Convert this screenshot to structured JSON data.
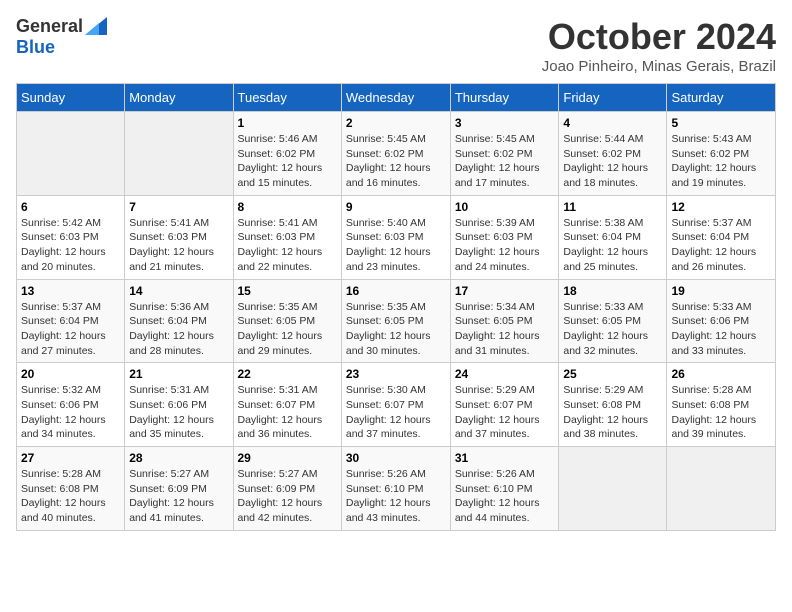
{
  "header": {
    "logo_general": "General",
    "logo_blue": "Blue",
    "month_title": "October 2024",
    "location": "Joao Pinheiro, Minas Gerais, Brazil"
  },
  "days_of_week": [
    "Sunday",
    "Monday",
    "Tuesday",
    "Wednesday",
    "Thursday",
    "Friday",
    "Saturday"
  ],
  "weeks": [
    [
      {
        "day": "",
        "sunrise": "",
        "sunset": "",
        "daylight": ""
      },
      {
        "day": "",
        "sunrise": "",
        "sunset": "",
        "daylight": ""
      },
      {
        "day": "1",
        "sunrise": "Sunrise: 5:46 AM",
        "sunset": "Sunset: 6:02 PM",
        "daylight": "Daylight: 12 hours and 15 minutes."
      },
      {
        "day": "2",
        "sunrise": "Sunrise: 5:45 AM",
        "sunset": "Sunset: 6:02 PM",
        "daylight": "Daylight: 12 hours and 16 minutes."
      },
      {
        "day": "3",
        "sunrise": "Sunrise: 5:45 AM",
        "sunset": "Sunset: 6:02 PM",
        "daylight": "Daylight: 12 hours and 17 minutes."
      },
      {
        "day": "4",
        "sunrise": "Sunrise: 5:44 AM",
        "sunset": "Sunset: 6:02 PM",
        "daylight": "Daylight: 12 hours and 18 minutes."
      },
      {
        "day": "5",
        "sunrise": "Sunrise: 5:43 AM",
        "sunset": "Sunset: 6:02 PM",
        "daylight": "Daylight: 12 hours and 19 minutes."
      }
    ],
    [
      {
        "day": "6",
        "sunrise": "Sunrise: 5:42 AM",
        "sunset": "Sunset: 6:03 PM",
        "daylight": "Daylight: 12 hours and 20 minutes."
      },
      {
        "day": "7",
        "sunrise": "Sunrise: 5:41 AM",
        "sunset": "Sunset: 6:03 PM",
        "daylight": "Daylight: 12 hours and 21 minutes."
      },
      {
        "day": "8",
        "sunrise": "Sunrise: 5:41 AM",
        "sunset": "Sunset: 6:03 PM",
        "daylight": "Daylight: 12 hours and 22 minutes."
      },
      {
        "day": "9",
        "sunrise": "Sunrise: 5:40 AM",
        "sunset": "Sunset: 6:03 PM",
        "daylight": "Daylight: 12 hours and 23 minutes."
      },
      {
        "day": "10",
        "sunrise": "Sunrise: 5:39 AM",
        "sunset": "Sunset: 6:03 PM",
        "daylight": "Daylight: 12 hours and 24 minutes."
      },
      {
        "day": "11",
        "sunrise": "Sunrise: 5:38 AM",
        "sunset": "Sunset: 6:04 PM",
        "daylight": "Daylight: 12 hours and 25 minutes."
      },
      {
        "day": "12",
        "sunrise": "Sunrise: 5:37 AM",
        "sunset": "Sunset: 6:04 PM",
        "daylight": "Daylight: 12 hours and 26 minutes."
      }
    ],
    [
      {
        "day": "13",
        "sunrise": "Sunrise: 5:37 AM",
        "sunset": "Sunset: 6:04 PM",
        "daylight": "Daylight: 12 hours and 27 minutes."
      },
      {
        "day": "14",
        "sunrise": "Sunrise: 5:36 AM",
        "sunset": "Sunset: 6:04 PM",
        "daylight": "Daylight: 12 hours and 28 minutes."
      },
      {
        "day": "15",
        "sunrise": "Sunrise: 5:35 AM",
        "sunset": "Sunset: 6:05 PM",
        "daylight": "Daylight: 12 hours and 29 minutes."
      },
      {
        "day": "16",
        "sunrise": "Sunrise: 5:35 AM",
        "sunset": "Sunset: 6:05 PM",
        "daylight": "Daylight: 12 hours and 30 minutes."
      },
      {
        "day": "17",
        "sunrise": "Sunrise: 5:34 AM",
        "sunset": "Sunset: 6:05 PM",
        "daylight": "Daylight: 12 hours and 31 minutes."
      },
      {
        "day": "18",
        "sunrise": "Sunrise: 5:33 AM",
        "sunset": "Sunset: 6:05 PM",
        "daylight": "Daylight: 12 hours and 32 minutes."
      },
      {
        "day": "19",
        "sunrise": "Sunrise: 5:33 AM",
        "sunset": "Sunset: 6:06 PM",
        "daylight": "Daylight: 12 hours and 33 minutes."
      }
    ],
    [
      {
        "day": "20",
        "sunrise": "Sunrise: 5:32 AM",
        "sunset": "Sunset: 6:06 PM",
        "daylight": "Daylight: 12 hours and 34 minutes."
      },
      {
        "day": "21",
        "sunrise": "Sunrise: 5:31 AM",
        "sunset": "Sunset: 6:06 PM",
        "daylight": "Daylight: 12 hours and 35 minutes."
      },
      {
        "day": "22",
        "sunrise": "Sunrise: 5:31 AM",
        "sunset": "Sunset: 6:07 PM",
        "daylight": "Daylight: 12 hours and 36 minutes."
      },
      {
        "day": "23",
        "sunrise": "Sunrise: 5:30 AM",
        "sunset": "Sunset: 6:07 PM",
        "daylight": "Daylight: 12 hours and 37 minutes."
      },
      {
        "day": "24",
        "sunrise": "Sunrise: 5:29 AM",
        "sunset": "Sunset: 6:07 PM",
        "daylight": "Daylight: 12 hours and 37 minutes."
      },
      {
        "day": "25",
        "sunrise": "Sunrise: 5:29 AM",
        "sunset": "Sunset: 6:08 PM",
        "daylight": "Daylight: 12 hours and 38 minutes."
      },
      {
        "day": "26",
        "sunrise": "Sunrise: 5:28 AM",
        "sunset": "Sunset: 6:08 PM",
        "daylight": "Daylight: 12 hours and 39 minutes."
      }
    ],
    [
      {
        "day": "27",
        "sunrise": "Sunrise: 5:28 AM",
        "sunset": "Sunset: 6:08 PM",
        "daylight": "Daylight: 12 hours and 40 minutes."
      },
      {
        "day": "28",
        "sunrise": "Sunrise: 5:27 AM",
        "sunset": "Sunset: 6:09 PM",
        "daylight": "Daylight: 12 hours and 41 minutes."
      },
      {
        "day": "29",
        "sunrise": "Sunrise: 5:27 AM",
        "sunset": "Sunset: 6:09 PM",
        "daylight": "Daylight: 12 hours and 42 minutes."
      },
      {
        "day": "30",
        "sunrise": "Sunrise: 5:26 AM",
        "sunset": "Sunset: 6:10 PM",
        "daylight": "Daylight: 12 hours and 43 minutes."
      },
      {
        "day": "31",
        "sunrise": "Sunrise: 5:26 AM",
        "sunset": "Sunset: 6:10 PM",
        "daylight": "Daylight: 12 hours and 44 minutes."
      },
      {
        "day": "",
        "sunrise": "",
        "sunset": "",
        "daylight": ""
      },
      {
        "day": "",
        "sunrise": "",
        "sunset": "",
        "daylight": ""
      }
    ]
  ]
}
